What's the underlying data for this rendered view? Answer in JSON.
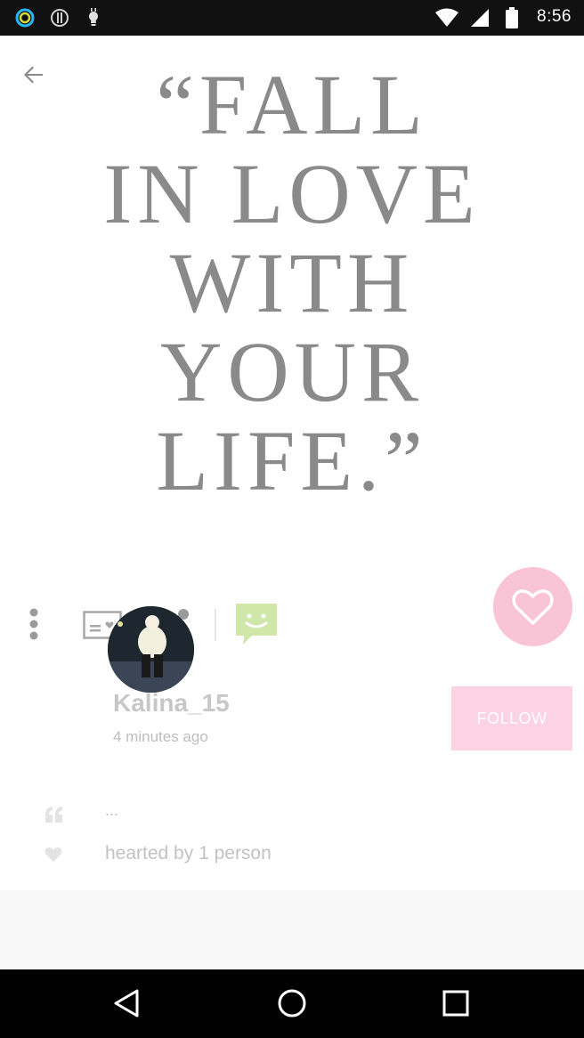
{
  "status_bar": {
    "time": "8:56",
    "left_icons": [
      "circle-notification-icon",
      "alert-notification-icon",
      "bulb-notification-icon"
    ],
    "right_icons": [
      "wifi-icon",
      "signal-icon",
      "battery-icon"
    ]
  },
  "quote": {
    "text": "“FALL\nIN LOVE\nWITH\nYOUR\nLIFE.”"
  },
  "post": {
    "username": "Kalina_15",
    "timestamp": "4 minutes ago",
    "follow_label": "FOLLOW",
    "caption": "...",
    "hearted_by": "hearted by 1 person"
  },
  "colors": {
    "accent_pink": "#f8c4d6",
    "follow_pink": "#fbd3e2",
    "chat_green": "#cfe8a9",
    "quote_gray": "#8a8a8a"
  }
}
